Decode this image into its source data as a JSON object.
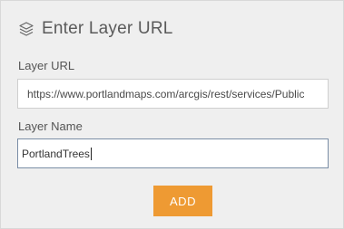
{
  "header": {
    "icon": "layers-icon",
    "title": "Enter Layer URL"
  },
  "layer_url": {
    "label": "Layer URL",
    "value": "https://www.portlandmaps.com/arcgis/rest/services/Public"
  },
  "layer_name": {
    "label": "Layer Name",
    "value": "PortlandTrees"
  },
  "actions": {
    "add_label": "ADD"
  },
  "colors": {
    "panel_background": "#efefef",
    "accent": "#ee9a33",
    "focused_border": "#7a8da6"
  }
}
